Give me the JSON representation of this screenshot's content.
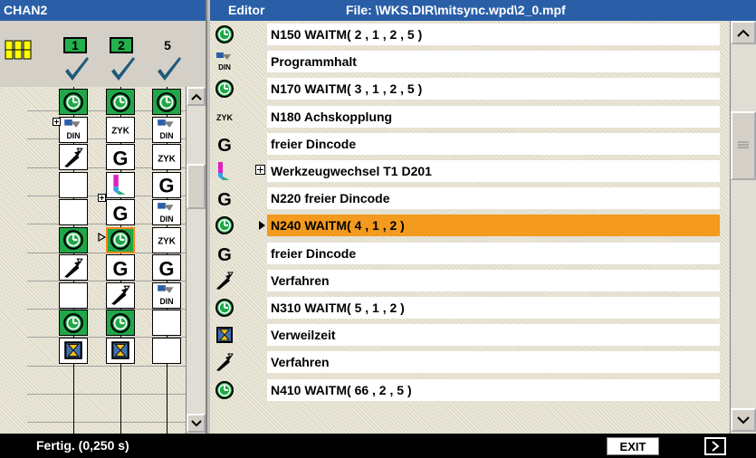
{
  "left_panel": {
    "title": "CHAN2",
    "channels": [
      {
        "number": "1",
        "active": true,
        "checked": true
      },
      {
        "number": "2",
        "active": true,
        "checked": true
      },
      {
        "number": "5",
        "active": false,
        "checked": true
      }
    ],
    "columns": [
      [
        "clock",
        "din",
        "move",
        "empty",
        "empty",
        "clock",
        "move",
        "empty",
        "clock",
        "wait"
      ],
      [
        "clock",
        "zyk",
        "g",
        "tool",
        "g",
        "clock",
        "g",
        "move",
        "clock",
        "wait"
      ],
      [
        "clock",
        "din",
        "zyk",
        "g",
        "din",
        "zyk",
        "g",
        "din",
        "empty",
        "empty"
      ]
    ]
  },
  "editor": {
    "title": "Editor",
    "file_label": "File: \\WKS.DIR\\mitsync.wpd\\2_0.mpf",
    "rows": [
      {
        "icon": "clock",
        "text": "N150 WAITM( 2 , 1 , 2 , 5 )"
      },
      {
        "icon": "din",
        "text": "Programmhalt"
      },
      {
        "icon": "clock",
        "text": "N170 WAITM( 3 , 1 , 2 , 5 )"
      },
      {
        "icon": "zyk",
        "text": "N180 Achskopplung"
      },
      {
        "icon": "g",
        "text": "freier Dincode"
      },
      {
        "icon": "tool",
        "text": "Werkzeugwechsel T1 D201",
        "expandable": true
      },
      {
        "icon": "g",
        "text": "N220 freier Dincode"
      },
      {
        "icon": "clock",
        "text": "N240 WAITM( 4 , 1 , 2 )",
        "selected": true
      },
      {
        "icon": "g",
        "text": "freier Dincode"
      },
      {
        "icon": "move",
        "text": "Verfahren"
      },
      {
        "icon": "clock",
        "text": "N310 WAITM( 5 , 1 , 2 )"
      },
      {
        "icon": "wait",
        "text": "Verweilzeit"
      },
      {
        "icon": "move",
        "text": "Verfahren"
      },
      {
        "icon": "clock",
        "text": "N410 WAITM( 66 , 2 , 5 )"
      }
    ]
  },
  "status_bar": {
    "text": "Fertig. (0,250 s)",
    "exit_label": "EXIT"
  },
  "icons": {
    "clock": "clock-icon",
    "din": "din-icon",
    "zyk": "zyk-icon",
    "g": "g-code-icon",
    "tool": "tool-change-icon",
    "move": "traverse-icon",
    "wait": "dwell-icon"
  },
  "colors": {
    "title_bar": "#2a5fa8",
    "selection": "#f39a1f",
    "sync_green": "#21a64a"
  }
}
